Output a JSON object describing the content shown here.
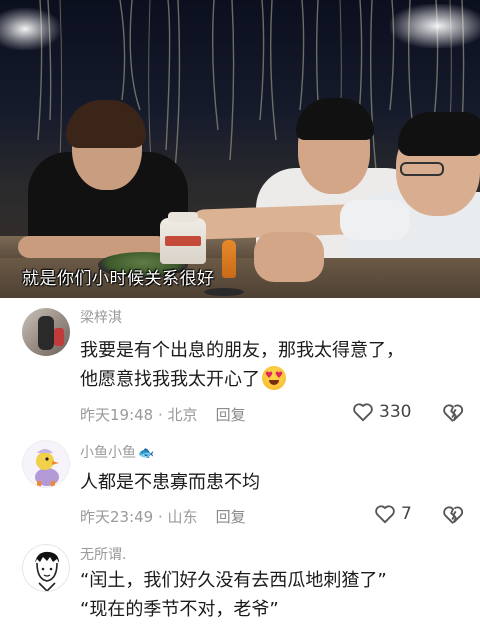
{
  "video": {
    "subtitle": "就是你们小时候关系很好"
  },
  "comments": [
    {
      "username": "梁梓淇",
      "text_lines": [
        "我要是有个出息的朋友，那我太得意了，",
        "他愿意找我我太开心了"
      ],
      "emoji": "heart-eyes-emoji",
      "time": "昨天19:48",
      "location": "北京",
      "reply_label": "回复",
      "likes": "330"
    },
    {
      "username": "小鱼小鱼",
      "username_icon": "fish-icon",
      "text_lines": [
        "人都是不患寡而患不均"
      ],
      "time": "昨天23:49",
      "location": "山东",
      "reply_label": "回复",
      "likes": "7"
    },
    {
      "username": "无所谓.",
      "text_lines": [
        "“闰土，我们好久没有去西瓜地刺猹了”",
        "“现在的季节不对，老爷”"
      ]
    }
  ],
  "separator": " · ",
  "colors": {
    "meta_gray": "#9a9a9a",
    "text_dark": "#1b1b1b",
    "subtitle": "#ffffff"
  }
}
